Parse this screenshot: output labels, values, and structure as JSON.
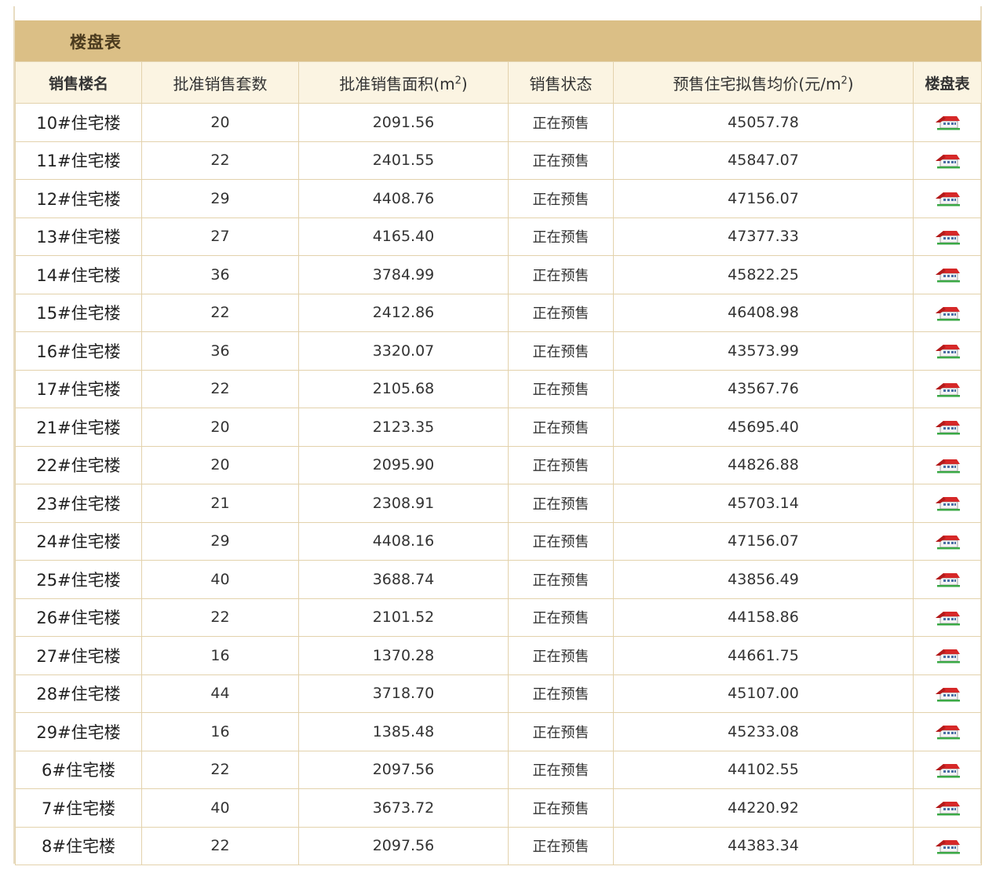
{
  "title": "楼盘表",
  "headers": {
    "name": "销售楼名",
    "count": "批准销售套数",
    "area_prefix": "批准销售面积(m",
    "area_sup": "2",
    "area_suffix": ")",
    "status": "销售状态",
    "price_prefix": "预售住宅拟售均价(元/m",
    "price_sup": "2",
    "price_suffix": ")",
    "table": "楼盘表"
  },
  "rows": [
    {
      "name": "10#住宅楼",
      "count": "20",
      "area": "2091.56",
      "status": "正在预售",
      "price": "45057.78"
    },
    {
      "name": "11#住宅楼",
      "count": "22",
      "area": "2401.55",
      "status": "正在预售",
      "price": "45847.07"
    },
    {
      "name": "12#住宅楼",
      "count": "29",
      "area": "4408.76",
      "status": "正在预售",
      "price": "47156.07"
    },
    {
      "name": "13#住宅楼",
      "count": "27",
      "area": "4165.40",
      "status": "正在预售",
      "price": "47377.33"
    },
    {
      "name": "14#住宅楼",
      "count": "36",
      "area": "3784.99",
      "status": "正在预售",
      "price": "45822.25"
    },
    {
      "name": "15#住宅楼",
      "count": "22",
      "area": "2412.86",
      "status": "正在预售",
      "price": "46408.98"
    },
    {
      "name": "16#住宅楼",
      "count": "36",
      "area": "3320.07",
      "status": "正在预售",
      "price": "43573.99"
    },
    {
      "name": "17#住宅楼",
      "count": "22",
      "area": "2105.68",
      "status": "正在预售",
      "price": "43567.76"
    },
    {
      "name": "21#住宅楼",
      "count": "20",
      "area": "2123.35",
      "status": "正在预售",
      "price": "45695.40"
    },
    {
      "name": "22#住宅楼",
      "count": "20",
      "area": "2095.90",
      "status": "正在预售",
      "price": "44826.88"
    },
    {
      "name": "23#住宅楼",
      "count": "21",
      "area": "2308.91",
      "status": "正在预售",
      "price": "45703.14"
    },
    {
      "name": "24#住宅楼",
      "count": "29",
      "area": "4408.16",
      "status": "正在预售",
      "price": "47156.07"
    },
    {
      "name": "25#住宅楼",
      "count": "40",
      "area": "3688.74",
      "status": "正在预售",
      "price": "43856.49"
    },
    {
      "name": "26#住宅楼",
      "count": "22",
      "area": "2101.52",
      "status": "正在预售",
      "price": "44158.86"
    },
    {
      "name": "27#住宅楼",
      "count": "16",
      "area": "1370.28",
      "status": "正在预售",
      "price": "44661.75"
    },
    {
      "name": "28#住宅楼",
      "count": "44",
      "area": "3718.70",
      "status": "正在预售",
      "price": "45107.00"
    },
    {
      "name": "29#住宅楼",
      "count": "16",
      "area": "1385.48",
      "status": "正在预售",
      "price": "45233.08"
    },
    {
      "name": "6#住宅楼",
      "count": "22",
      "area": "2097.56",
      "status": "正在预售",
      "price": "44102.55"
    },
    {
      "name": "7#住宅楼",
      "count": "40",
      "area": "3673.72",
      "status": "正在预售",
      "price": "44220.92"
    },
    {
      "name": "8#住宅楼",
      "count": "22",
      "area": "2097.56",
      "status": "正在预售",
      "price": "44383.34"
    }
  ],
  "icon": "house-icon",
  "colors": {
    "title_bar": "#dbbf86",
    "header_bg": "#fbf4e2",
    "border": "#e3d2ac",
    "roof": "#d62828"
  }
}
